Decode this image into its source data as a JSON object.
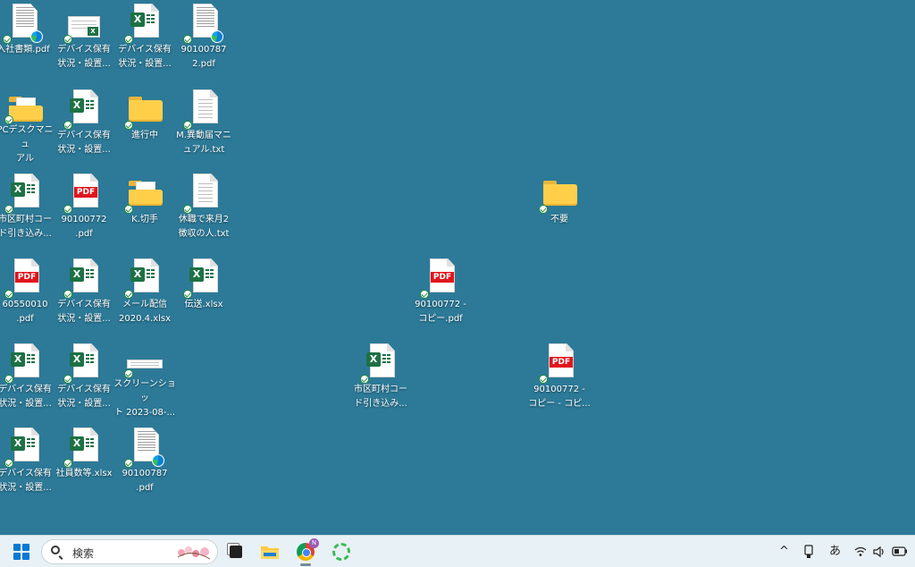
{
  "desktop": {
    "icons": [
      {
        "label": "入社書類.pdf",
        "type": "scan-edge"
      },
      {
        "label": "デバイス保有\n状況・設置...",
        "type": "thumb-xl"
      },
      {
        "label": "デバイス保有\n状況・設置...",
        "type": "excel"
      },
      {
        "label": "90100787\n2.pdf",
        "type": "scan-edge"
      },
      {
        "label": "PCデスクマニュ\nアル",
        "type": "folder-doc"
      },
      {
        "label": "デバイス保有\n状況・設置...",
        "type": "excel"
      },
      {
        "label": "進行中",
        "type": "folder"
      },
      {
        "label": "M.異動届マニ\nュアル.txt",
        "type": "text"
      },
      {
        "label": "市区町村コー\nド引き込み...",
        "type": "excel"
      },
      {
        "label": "90100772\n.pdf",
        "type": "pdf"
      },
      {
        "label": "K.切手",
        "type": "folder-doc"
      },
      {
        "label": "休職で来月2\n徴収の人.txt",
        "type": "text"
      },
      {
        "label": "不要",
        "type": "folder"
      },
      {
        "label": "60550010\n.pdf",
        "type": "pdf"
      },
      {
        "label": "デバイス保有\n状況・設置...",
        "type": "excel"
      },
      {
        "label": "メール配信\n2020.4.xlsx",
        "type": "excel"
      },
      {
        "label": "伝送.xlsx",
        "type": "excel"
      },
      {
        "label": "90100772 -\nコピー.pdf",
        "type": "pdf"
      },
      {
        "label": "デバイス保有\n状況・設置...",
        "type": "excel"
      },
      {
        "label": "デバイス保有\n状況・設置...",
        "type": "excel"
      },
      {
        "label": "スクリーンショッ\nト 2023-08-...",
        "type": "screenshot"
      },
      {
        "label": "市区町村コー\nド引き込み...",
        "type": "excel"
      },
      {
        "label": "90100772 -\nコピー - コピ...",
        "type": "pdf"
      },
      {
        "label": "デバイス保有\n状況・設置...",
        "type": "excel"
      },
      {
        "label": "社員数等.xlsx",
        "type": "excel"
      },
      {
        "label": "90100787\n.pdf",
        "type": "scan-edge"
      }
    ]
  },
  "taskbar": {
    "search_placeholder": "検索",
    "apps": [
      "start-menu",
      "search",
      "task-view",
      "file-explorer",
      "chrome",
      "green-ring-app"
    ],
    "chrome_badge": "N",
    "tray": {
      "chevron": "^",
      "ime": "あ"
    }
  },
  "colors": {
    "desktop_bg": "#2c7a98",
    "taskbar_bg": "#e8f1f5",
    "excel_green": "#1e7145",
    "pdf_red": "#e0151d",
    "folder_yellow": "#ffcf4a"
  },
  "pdf_label": "PDF",
  "excel_label": "X"
}
